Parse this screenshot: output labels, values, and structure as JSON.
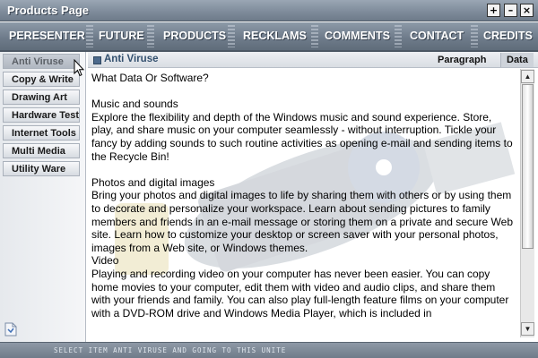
{
  "window": {
    "title": "Products Page",
    "controls": {
      "maximize": "+",
      "minimize": "–",
      "close": "×"
    }
  },
  "nav": {
    "items": [
      {
        "label": "PERESENTER"
      },
      {
        "label": "FUTURE"
      },
      {
        "label": "PRODUCTS"
      },
      {
        "label": "RECKLAMS"
      },
      {
        "label": "COMMENTS"
      },
      {
        "label": "CONTACT"
      },
      {
        "label": "CREDITS"
      }
    ]
  },
  "sidebar": {
    "items": [
      {
        "label": "Anti Viruse",
        "active": true
      },
      {
        "label": "Copy & Write"
      },
      {
        "label": "Drawing Art"
      },
      {
        "label": "Hardware Test"
      },
      {
        "label": "Internet Tools"
      },
      {
        "label": "Multi Media"
      },
      {
        "label": "Utility Ware"
      }
    ]
  },
  "content": {
    "section_title": "Anti Viruse",
    "tabs": {
      "paragraph": "Paragraph",
      "data": "Data"
    },
    "heading": "What Data Or Software?",
    "blocks": [
      {
        "title": "Music and sounds",
        "body": "Explore the flexibility and depth of the Windows music and sound experience. Store, play, and share music on your computer seamlessly - without interruption. Tickle your fancy by adding sounds to such routine activities as opening e-mail and sending items to the Recycle Bin!"
      },
      {
        "title": "Photos and digital images",
        "body": "Bring your photos and digital images to life by sharing them with others or by using them to decorate and personalize your workspace. Learn about sending pictures to family members and friends in an e-mail message or storing them on a private and secure Web site. Learn how to customize your desktop or screen saver with your personal photos, images from a Web site, or Windows themes."
      },
      {
        "title": "Video",
        "body": "Playing and recording video on your computer has never been easier. You can copy home movies to your computer, edit them with video and audio clips, and share them with your friends and family. You can also play full-length feature films on your computer with a DVD-ROM drive and Windows Media Player, which is included in"
      }
    ]
  },
  "statusbar": {
    "text": "SELECT ITEM ANTI VIRUSE AND GOING TO THIS UNITE"
  },
  "colors": {
    "nav_bg": "#6f7c8b",
    "accent_title": "#33506e",
    "status_bg": "#7e8a98"
  }
}
